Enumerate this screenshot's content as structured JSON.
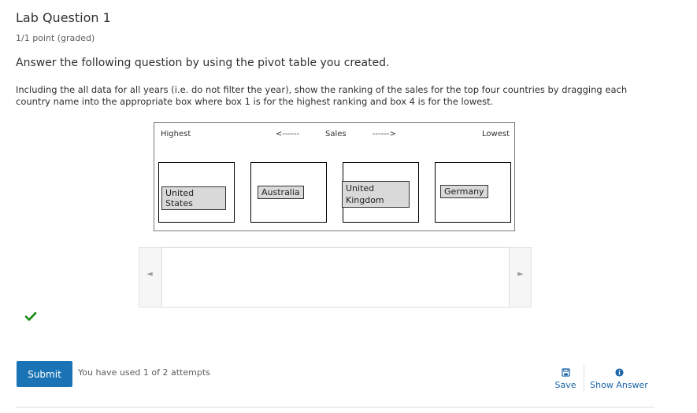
{
  "problem": {
    "title": "Lab Question 1",
    "points": "1/1 point (graded)",
    "question": "Answer the following question by using the pivot table you created.",
    "instructions": "Including the all data for all years (i.e. do not filter the year), show the ranking of the sales for the top four countries by dragging each country name into the appropriate box where box 1 is for the highest ranking and box 4 is for the lowest."
  },
  "dnd": {
    "header": {
      "highest": "Highest",
      "arrow_left": "<------",
      "sales": "Sales",
      "arrow_right": "------>",
      "lowest": "Lowest"
    },
    "boxes": [
      {
        "item": "United States"
      },
      {
        "item": "Australia"
      },
      {
        "item": "United Kingdom"
      },
      {
        "item": "Germany"
      }
    ],
    "scroll_left": "◄",
    "scroll_right": "►"
  },
  "status": {
    "correct": true,
    "color": "#118811"
  },
  "footer": {
    "submit_label": "Submit",
    "attempts_text": "You have used 1 of 2 attempts",
    "save_label": "Save",
    "show_answer_label": "Show Answer",
    "link_color": "#1a64a8",
    "submit_color": "#1a73b5"
  }
}
